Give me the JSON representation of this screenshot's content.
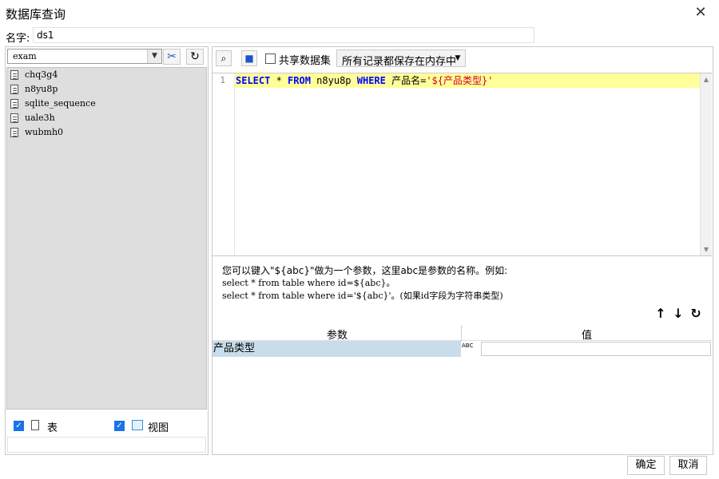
{
  "window": {
    "title": "数据库查询",
    "close_icon": "✕"
  },
  "name_field": {
    "label": "名字:",
    "value": "ds1"
  },
  "left_panel": {
    "database": "exam",
    "tables": [
      "chq3g4",
      "n8yu8p",
      "sqlite_sequence",
      "uale3h",
      "wubmh0"
    ],
    "checkboxes": [
      {
        "label": "表",
        "checked": true
      },
      {
        "label": "视图",
        "checked": true
      }
    ]
  },
  "toolbar": {
    "share_label": "共享数据集",
    "memory_option": "所有记录都保存在内存中"
  },
  "editor": {
    "line_number": "1",
    "sql": {
      "kw1": "SELECT",
      "t1": " * ",
      "kw2": "FROM",
      "t2": " n8yu8p ",
      "kw3": "WHERE",
      "t3": " 产品名=",
      "str": "'${产品类型}'"
    }
  },
  "hint": {
    "line1": "您可以键入\"${abc}\"做为一个参数，这里abc是参数的名称。例如:",
    "line2": "select * from table where id=${abc}。",
    "line3": "select * from table where id='${abc}'。(如果id字段为字符串类型)"
  },
  "params": {
    "headers": [
      "参数",
      "值"
    ],
    "rows": [
      {
        "name": "产品类型",
        "type_icon": "ABC",
        "value": ""
      }
    ]
  },
  "buttons": {
    "ok": "确定",
    "cancel": "取消"
  }
}
